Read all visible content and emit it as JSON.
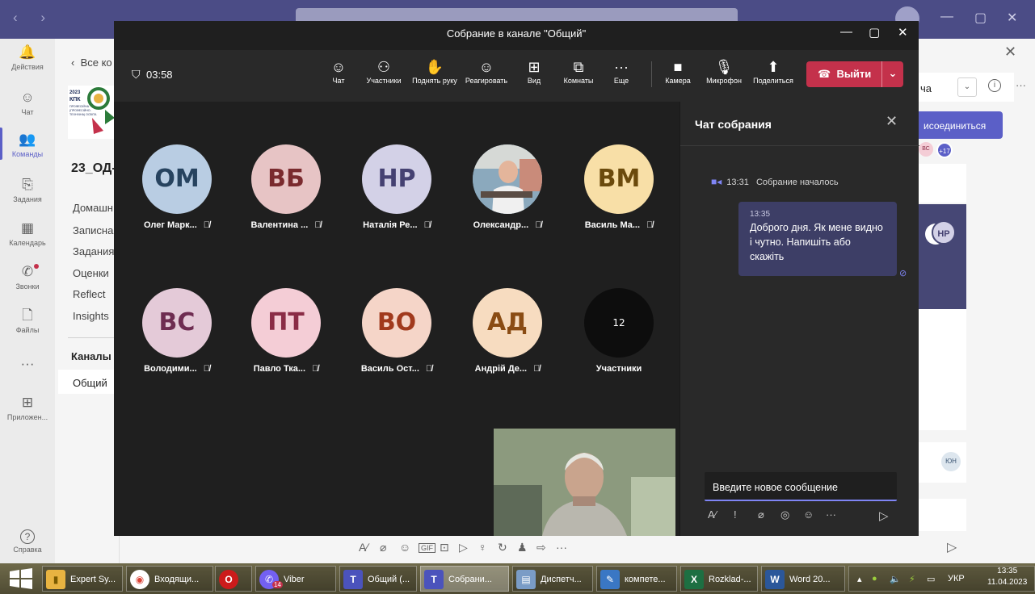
{
  "meeting": {
    "title": "Собрание в канале \"Общий\"",
    "timer": "03:58",
    "toolbar": [
      {
        "label": "Чат",
        "icon": "☺"
      },
      {
        "label": "Участники",
        "icon": "⚇"
      },
      {
        "label": "Поднять руку",
        "icon": "✋"
      },
      {
        "label": "Реагировать",
        "icon": "☺"
      },
      {
        "label": "Вид",
        "icon": "⊞"
      },
      {
        "label": "Комнаты",
        "icon": "⧉"
      },
      {
        "label": "Еще",
        "icon": "···"
      },
      {
        "label": "Камера",
        "icon": "■"
      },
      {
        "label": "Микрофон",
        "icon": "🎙"
      },
      {
        "label": "Поделиться",
        "icon": "⬆"
      }
    ],
    "leave_label": "Выйти",
    "participants": [
      {
        "initials": "ОМ",
        "name": "Олег Марк...",
        "bg": "#b9cde3",
        "fg": "#27435f"
      },
      {
        "initials": "ВБ",
        "name": "Валентина ...",
        "bg": "#e7c4c5",
        "fg": "#7a2a2e"
      },
      {
        "initials": "НР",
        "name": "Наталія Ре...",
        "bg": "#d3d1e7",
        "fg": "#454172"
      },
      {
        "initials": "",
        "name": "Олександр...",
        "bg": "#a9a49b",
        "fg": "#333333"
      },
      {
        "initials": "ВМ",
        "name": "Василь Ма...",
        "bg": "#f8dfa7",
        "fg": "#6b4a0c"
      },
      {
        "initials": "ВС",
        "name": "Володими...",
        "bg": "#e4cad8",
        "fg": "#6e2c51"
      },
      {
        "initials": "ПТ",
        "name": "Павло Тка...",
        "bg": "#f4cdd6",
        "fg": "#8a2c46"
      },
      {
        "initials": "ВО",
        "name": "Василь Ост...",
        "bg": "#f5d5c8",
        "fg": "#a13a1d"
      },
      {
        "initials": "АД",
        "name": "Андрій Де...",
        "bg": "#f7dcc0",
        "fg": "#8a4c14"
      },
      {
        "initials": "12",
        "name": "Участники",
        "bg": "#0d0d0d",
        "fg": "#ffffff"
      }
    ],
    "chat": {
      "header": "Чат собрания",
      "event_time": "13:31",
      "event_text": "Собрание началось",
      "message_time": "13:35",
      "message_text": "Доброго дня. Як мене видно і чутно. Напишіть або скажіть",
      "input_placeholder": "Введите новое сообщение"
    }
  },
  "teams": {
    "rail": [
      {
        "label": "Действия",
        "icon": "🔔"
      },
      {
        "label": "Чат",
        "icon": "☺"
      },
      {
        "label": "Команды",
        "icon": "👥"
      },
      {
        "label": "Задания",
        "icon": "⎘"
      },
      {
        "label": "Календарь",
        "icon": "▦"
      },
      {
        "label": "Звонки",
        "icon": "✆"
      },
      {
        "label": "Файлы",
        "icon": "🗋"
      },
      {
        "label": "",
        "icon": "···"
      },
      {
        "label": "Приложен...",
        "icon": "⊞"
      },
      {
        "label": "Справка",
        "icon": "?"
      }
    ],
    "back_label": "Все ко",
    "logo_text": "2023 КПК ПРОФЕСІЙНА (ПРОФЕСІЙНО-ТЕХНІЧНА) ОСВІТА",
    "team_name": "23_ОД-",
    "tabs": [
      "Домашн",
      "Записна",
      "Задания",
      "Оценки",
      "Reflect",
      "Insights"
    ],
    "channels_header": "Каналы",
    "channel": "Общий",
    "right_dropdown": "ча",
    "join_label": "исоединиться",
    "badges": [
      "ВС",
      "+17",
      "НР",
      "ЮН"
    ]
  },
  "taskbar": {
    "apps": [
      {
        "label": "Expert Sy...",
        "icon": "▮",
        "color": "#e8b341"
      },
      {
        "label": "Входящи...",
        "icon": "◉",
        "color": "#db4437"
      },
      {
        "label": "",
        "icon": "O",
        "color": "#cc1b1b"
      },
      {
        "label": "Viber",
        "icon": "✆",
        "color": "#7360f2"
      },
      {
        "label": "Общий (...",
        "icon": "T",
        "color": "#4b53bc"
      },
      {
        "label": "Собрани...",
        "icon": "T",
        "color": "#4b53bc"
      },
      {
        "label": "Диспетч...",
        "icon": "▤",
        "color": "#7a9cc6"
      },
      {
        "label": "компете...",
        "icon": "✎",
        "color": "#3a77c4"
      },
      {
        "label": "Rozklad-...",
        "icon": "X",
        "color": "#1d6f42"
      },
      {
        "label": "Word 20...",
        "icon": "W",
        "color": "#2b579a"
      }
    ],
    "viber_badge": "14",
    "lang": "УКР",
    "time": "13:35",
    "date": "11.04.2023"
  }
}
